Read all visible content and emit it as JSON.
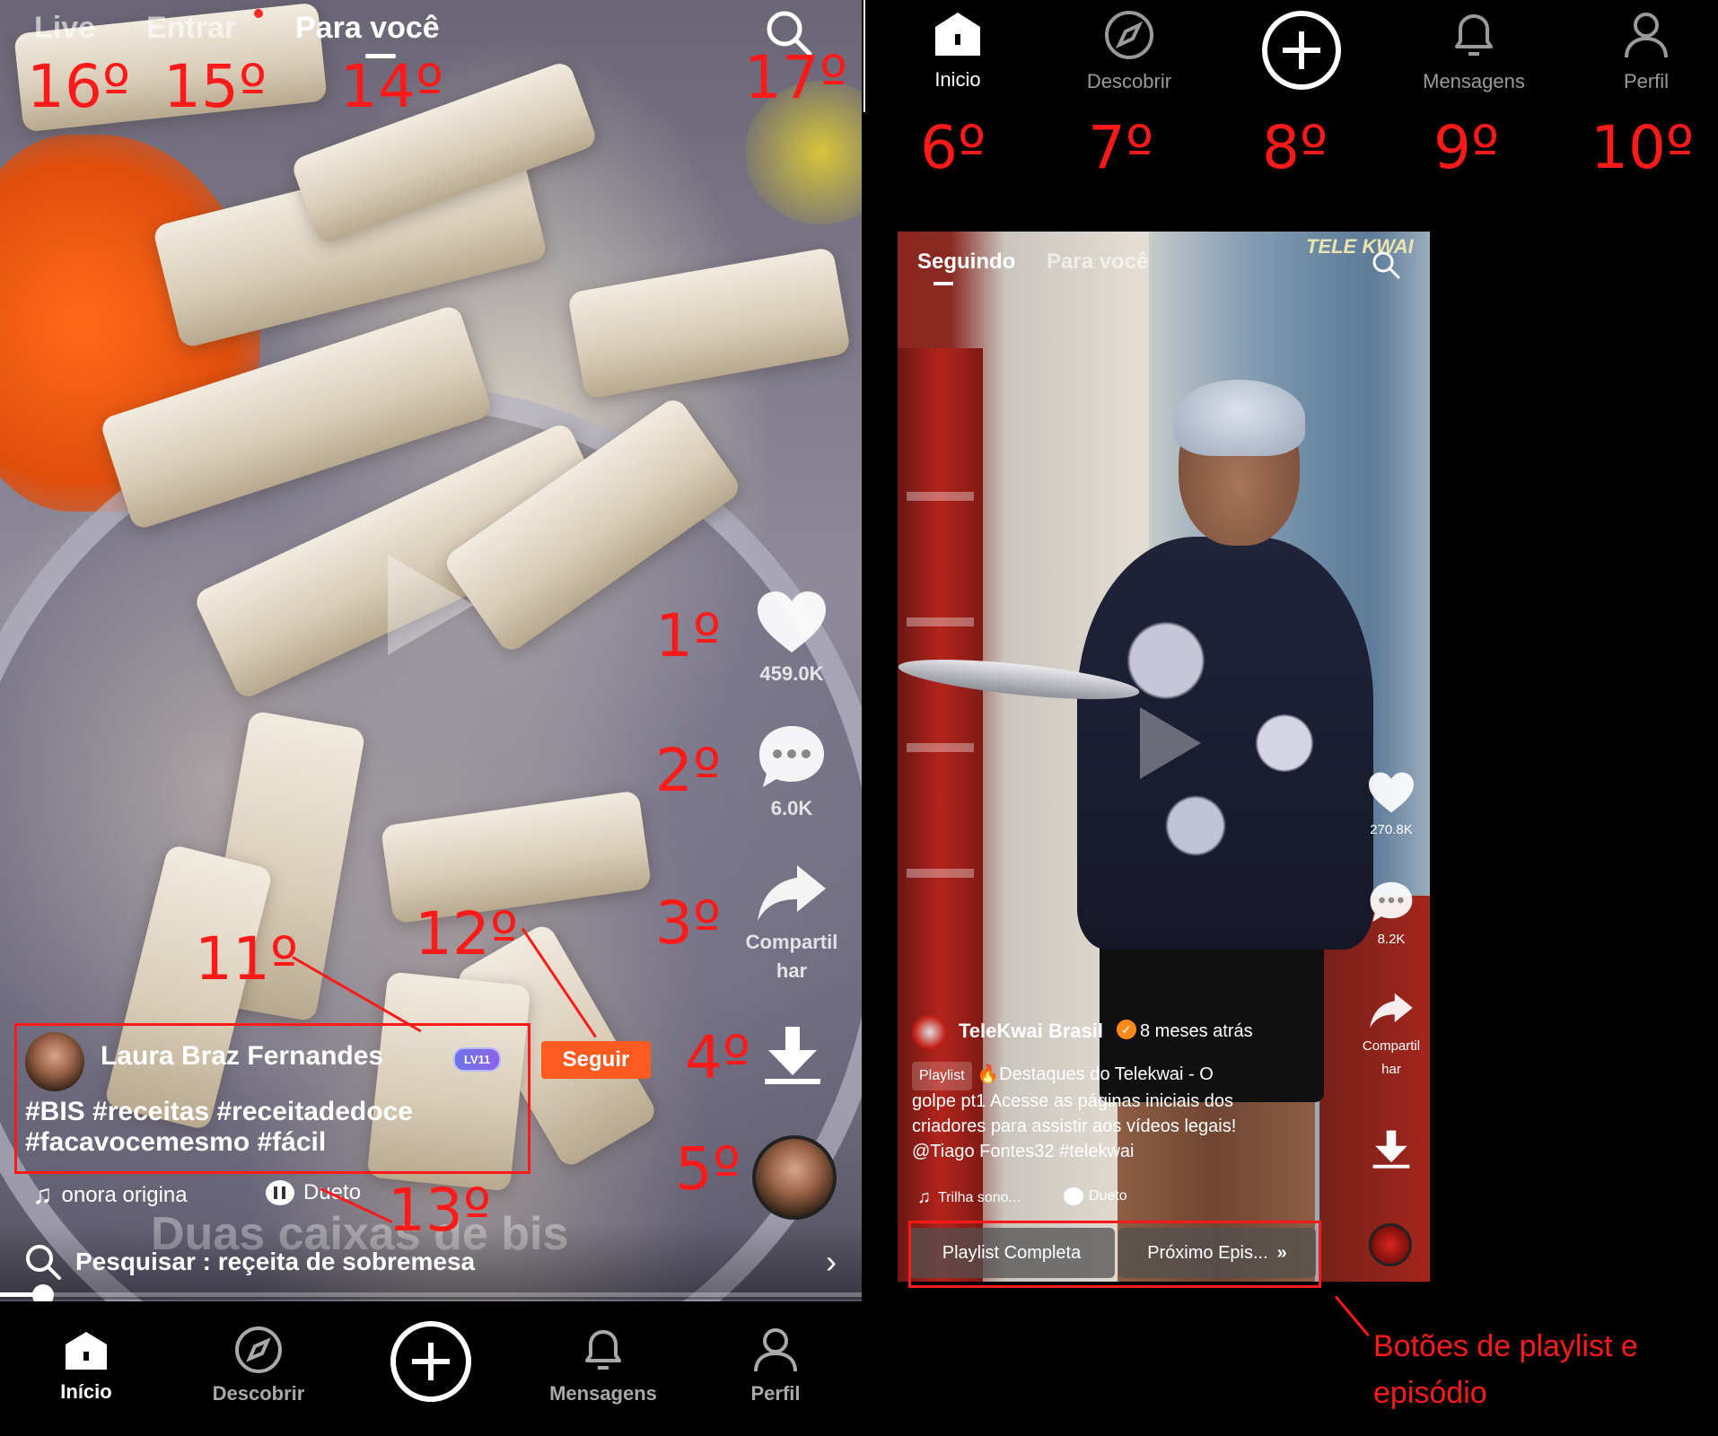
{
  "left": {
    "top_nav": {
      "live": "Live",
      "entrar": "Entrar",
      "para_voce": "Para você"
    },
    "actions": {
      "like_count": "459.0K",
      "comment_count": "6.0K",
      "share_label_1": "Compartil",
      "share_label_2": "har"
    },
    "creator": {
      "name": "Laura Braz Fernandes",
      "level": "LV11",
      "follow": "Seguir"
    },
    "caption_line1": "#BIS #receitas #receitadedoce",
    "caption_line2": "#facavocemesmo #fácil",
    "sound": "onora origina",
    "duet": "Dueto",
    "overlay_text": "Duas caixas de bis",
    "search": "Pesquisar : reçeita de sobremesa",
    "progress_fraction": 0.05,
    "bottom_nav": [
      "Início",
      "Descobrir",
      "",
      "Mensagens",
      "Perfil"
    ]
  },
  "right": {
    "nav": [
      "Inicio",
      "Descobrir",
      "",
      "Mensagens",
      "Perfil"
    ],
    "top": {
      "seguindo": "Seguindo",
      "para_voce": "Para você",
      "brand": "TELE KWAI"
    },
    "actions": {
      "like_count": "270.8K",
      "comment_count": "8.2K",
      "share_label_1": "Compartil",
      "share_label_2": "har"
    },
    "creator": {
      "name": "TeleKwai Brasil",
      "time": "8 meses atrás"
    },
    "playlist_badge": "Playlist",
    "caption_line1": "🔥Destaques do Telekwai - O",
    "caption_line2": "golpe pt1 Acesse as páginas iniciais dos",
    "caption_line3": "criadores para assistir aos vídeos legais!",
    "caption_line4": "@Tiago Fontes32 #telekwai",
    "sound": "Trilha sono...",
    "duet": "Dueto",
    "buttons": {
      "playlist": "Playlist Completa",
      "next": "Próximo Epis..."
    }
  },
  "annotations": {
    "n1": "1º",
    "n2": "2º",
    "n3": "3º",
    "n4": "4º",
    "n5": "5º",
    "n6": "6º",
    "n7": "7º",
    "n8": "8º",
    "n9": "9º",
    "n10": "10º",
    "n11": "11º",
    "n12": "12º",
    "n13": "13º",
    "n14": "14º",
    "n15": "15º",
    "n16": "16º",
    "n17": "17º",
    "playlist_caption_1": "Botões de playlist e",
    "playlist_caption_2": "episódio"
  },
  "colors": {
    "annotation_red": "#ff1a1a",
    "follow_orange": "#ff5a1f",
    "level_badge": "#7a6cf0"
  }
}
